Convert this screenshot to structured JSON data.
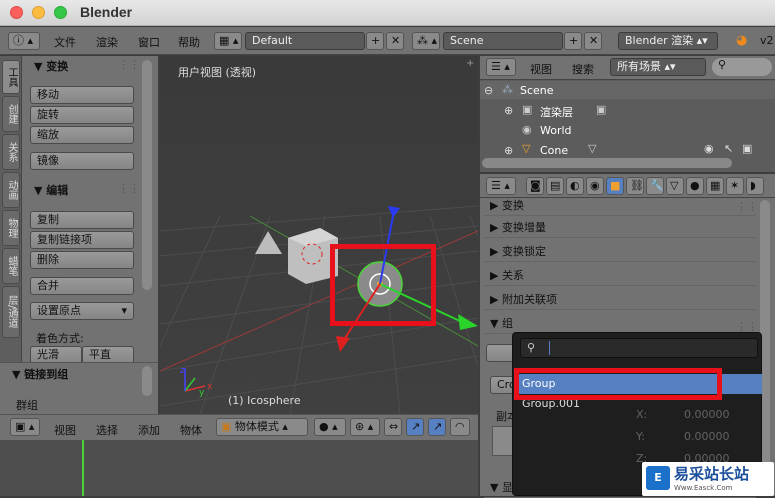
{
  "window": {
    "title": "Blender"
  },
  "topbar": {
    "menus": [
      "文件",
      "渲染",
      "窗口",
      "帮助"
    ],
    "layout": "Default",
    "scene": "Scene",
    "engine": "Blender 渲染",
    "version": "v2"
  },
  "toolshelf": {
    "tabs": [
      "工具",
      "创建",
      "关系",
      "动画",
      "物理",
      "蜡笔",
      "层/通道"
    ],
    "transform": {
      "title": "变换",
      "buttons": [
        "移动",
        "旋转",
        "缩放",
        "镜像"
      ]
    },
    "edit": {
      "title": "编辑",
      "buttons": [
        "复制",
        "复制链接项",
        "删除",
        "合并",
        "设置原点"
      ],
      "shading_label": "着色方式:",
      "smooth": "光滑",
      "flat": "平直"
    },
    "link_group": {
      "title": "链接到组",
      "group_label": "群组"
    }
  },
  "viewport": {
    "title": "用户视图 (透视)",
    "object_label": "(1) Icosphere",
    "axes": {
      "x": "x",
      "y": "y",
      "z": "z"
    }
  },
  "viewport_header": {
    "view": "视图",
    "select": "选择",
    "add": "添加",
    "object": "物体",
    "mode": "物体模式"
  },
  "outliner": {
    "view": "视图",
    "search": "搜索",
    "filter": "所有场景",
    "items": [
      {
        "label": "Scene",
        "indent": 0
      },
      {
        "label": "渲染层",
        "indent": 1
      },
      {
        "label": "World",
        "indent": 1
      },
      {
        "label": "Cone",
        "indent": 1
      }
    ]
  },
  "properties": {
    "sections": [
      "变换",
      "变换增量",
      "变换锁定",
      "关系",
      "附加关联项",
      "组"
    ],
    "bottom_section": "显示",
    "other": {
      "cro": "Cro",
      "duplicate": "副本",
      "x": "X:",
      "y": "Y:",
      "z": "Z:",
      "x_val": "0.00000",
      "y_val": "0.00000",
      "z_val": "0.00000"
    }
  },
  "popup": {
    "search_value": "",
    "items": [
      "Group",
      "Group.001"
    ],
    "selected": "Group"
  },
  "watermark": {
    "text": "易采站长站",
    "sub": "Www.Easck.Com"
  },
  "colors": {
    "accent": "#5680c2",
    "highlight": "#e8101a"
  }
}
